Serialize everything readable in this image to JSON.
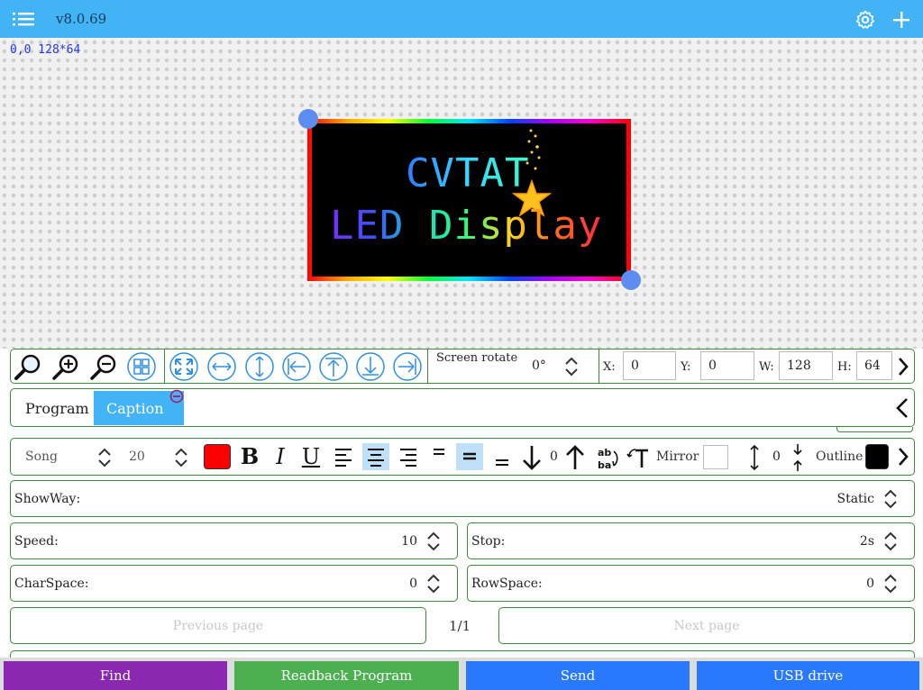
{
  "topbar": {
    "version": "v8.0.69"
  },
  "canvas": {
    "coords": "0,0 128*64",
    "preview_line1": "CVTAT",
    "preview_line2": "LED Display"
  },
  "toolbar": {
    "screen_rotate_label": "Screen rotate",
    "screen_rotate_value": "0°",
    "x_label": "X:",
    "x_value": "0",
    "y_label": "Y:",
    "y_value": "0",
    "w_label": "W:",
    "w_value": "128",
    "h_label": "H:",
    "h_value": "64"
  },
  "tabs": [
    {
      "label": "Program"
    },
    {
      "label": "Caption"
    }
  ],
  "fontrow": {
    "font": "Song",
    "size": "20",
    "text_color": "#ff0000",
    "bold": "B",
    "italic": "I",
    "underline": "U",
    "move_value": "0",
    "mirror_label": "Mirror",
    "line_space_value": "0",
    "outline_label": "Outline",
    "outline_color": "#000000"
  },
  "fields": {
    "showway": {
      "label": "ShowWay:",
      "value": "Static"
    },
    "speed": {
      "label": "Speed:",
      "value": "10"
    },
    "stop": {
      "label": "Stop:",
      "value": "2s"
    },
    "charspace": {
      "label": "CharSpace:",
      "value": "0"
    },
    "rowspace": {
      "label": "RowSpace:",
      "value": "0"
    }
  },
  "pager": {
    "previous": "Previous page",
    "next": "Next page",
    "indicator": "1/1"
  },
  "actions": {
    "find": "Find",
    "readback": "Readback Program",
    "send": "Send",
    "usb": "USB drive"
  },
  "colors": {
    "accent": "#42b3f5",
    "border": "#3a8a3a",
    "find": "#8b28b0",
    "readback": "#4cb050",
    "send": "#2979ff",
    "usb": "#2979ff"
  }
}
